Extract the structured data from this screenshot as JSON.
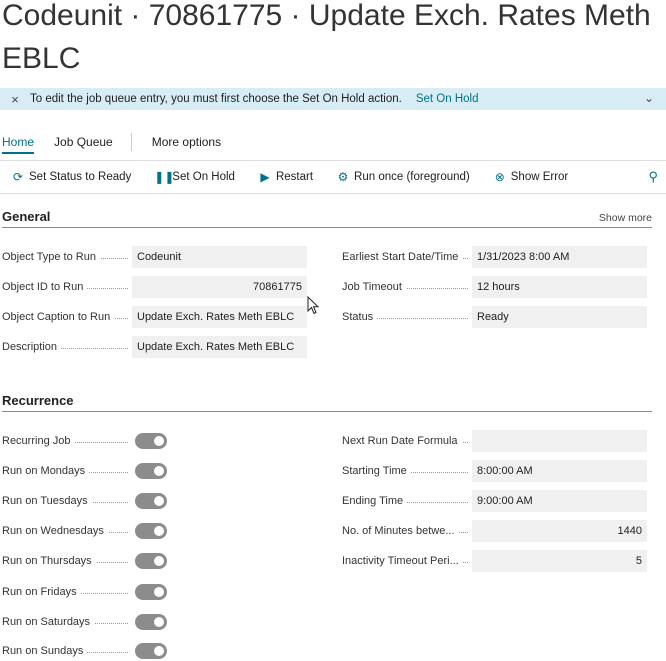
{
  "page": {
    "title": "Codeunit · 70861775 · Update Exch. Rates Meth EBLC"
  },
  "banner": {
    "close_icon": "×",
    "message": "To edit the job queue entry, you must first choose the Set On Hold action.",
    "link": "Set On Hold",
    "chevron_icon": "⌄"
  },
  "tabs": [
    "Home",
    "Job Queue",
    "More options"
  ],
  "actions": [
    {
      "icon": "⟳",
      "label": "Set Status to Ready"
    },
    {
      "icon": "❚❚",
      "label": "Set On Hold"
    },
    {
      "icon": "▶",
      "label": "Restart"
    },
    {
      "icon": "⚙",
      "label": "Run once (foreground)"
    },
    {
      "icon": "⊗",
      "label": "Show Error"
    }
  ],
  "pin_icon": "⚲",
  "general": {
    "title": "General",
    "show_more": "Show more",
    "left": [
      {
        "label": "Object Type to Run",
        "value": "Codeunit"
      },
      {
        "label": "Object ID to Run",
        "value": "70861775"
      },
      {
        "label": "Object Caption to Run",
        "value": "Update Exch. Rates Meth EBLC"
      },
      {
        "label": "Description",
        "value": "Update Exch. Rates Meth EBLC"
      }
    ],
    "right": [
      {
        "label": "Earliest Start Date/Time",
        "value": "1/31/2023 8:00 AM"
      },
      {
        "label": "Job Timeout",
        "value": "12 hours"
      },
      {
        "label": "Status",
        "value": "Ready"
      }
    ]
  },
  "recurrence": {
    "title": "Recurrence",
    "left": [
      {
        "label": "Recurring Job",
        "on": true
      },
      {
        "label": "Run on Mondays",
        "on": true
      },
      {
        "label": "Run on Tuesdays",
        "on": true
      },
      {
        "label": "Run on Wednesdays",
        "on": true
      },
      {
        "label": "Run on Thursdays",
        "on": true
      },
      {
        "label": "Run on Fridays",
        "on": true
      },
      {
        "label": "Run on Saturdays",
        "on": true
      },
      {
        "label": "Run on Sundays",
        "on": true
      }
    ],
    "right": [
      {
        "label": "Next Run Date Formula",
        "value": ""
      },
      {
        "label": "Starting Time",
        "value": "8:00:00 AM"
      },
      {
        "label": "Ending Time",
        "value": "9:00:00 AM"
      },
      {
        "label": "No. of Minutes betwe...",
        "value": "1440"
      },
      {
        "label": "Inactivity Timeout Peri...",
        "value": "5"
      }
    ]
  }
}
